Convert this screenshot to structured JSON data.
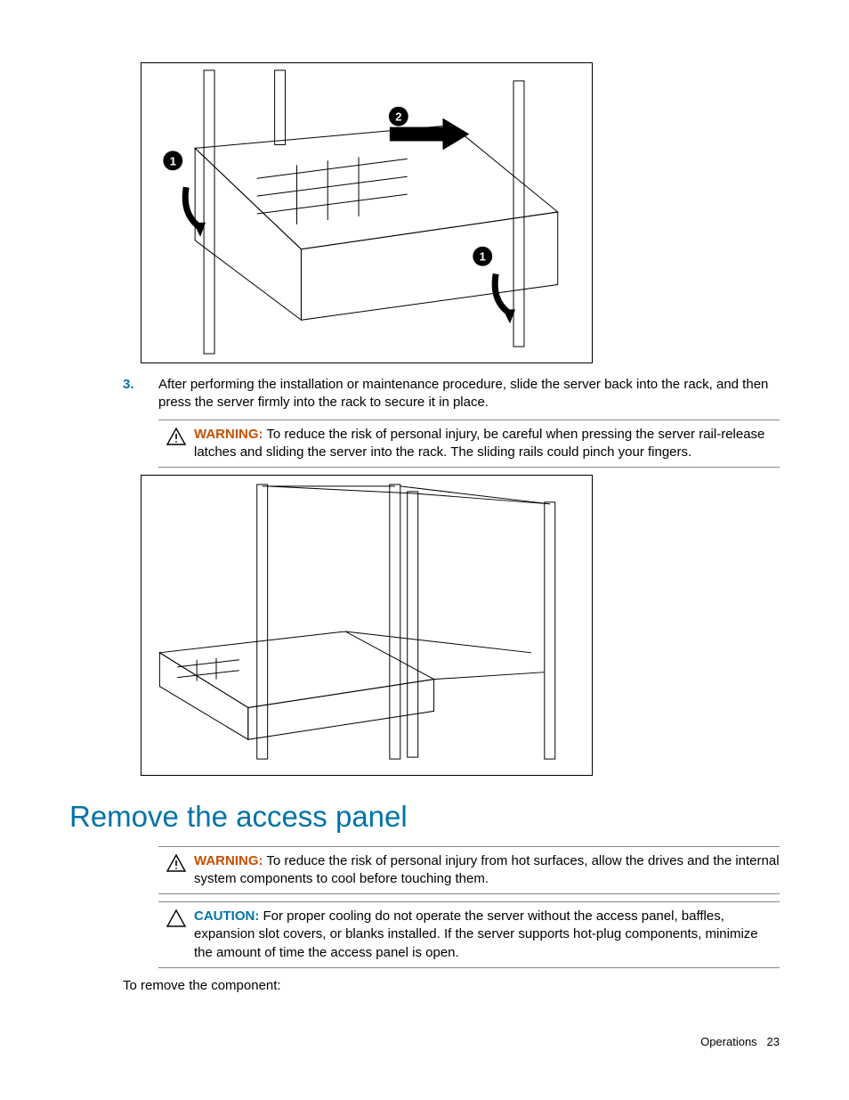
{
  "step3": {
    "number": "3.",
    "text": "After performing the installation or maintenance procedure, slide the server back into the rack, and then press the server firmly into the rack to secure it in place."
  },
  "warning1": {
    "label": "WARNING:",
    "text": "To reduce the risk of personal injury, be careful when pressing the server rail-release latches and sliding the server into the rack. The sliding rails could pinch your fingers."
  },
  "heading": "Remove the access panel",
  "warning2": {
    "label": "WARNING:",
    "text": "To reduce the risk of personal injury from hot surfaces, allow the drives and the internal system components to cool before touching them."
  },
  "caution1": {
    "label": "CAUTION:",
    "text": "For proper cooling do not operate the server without the access panel, baffles, expansion slot covers, or blanks installed. If the server supports hot-plug components, minimize the amount of time the access panel is open."
  },
  "intro_text": "To remove the component:",
  "footer": {
    "section": "Operations",
    "page": "23"
  },
  "figures": {
    "fig1_alt": "Server in rack with callouts 1 (latches) and 2 (slide direction arrow)",
    "fig2_alt": "Server being slid back into rack frame"
  }
}
